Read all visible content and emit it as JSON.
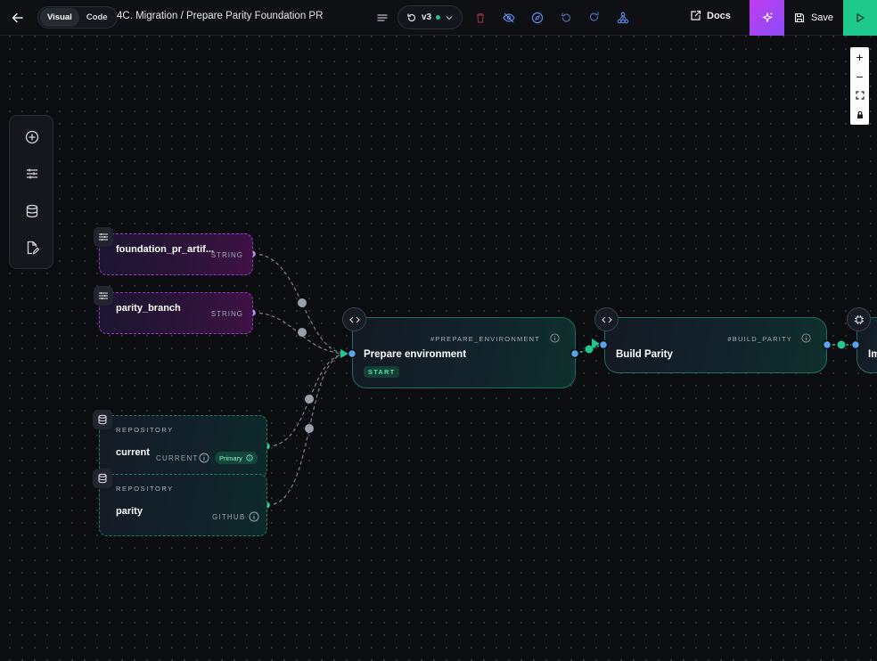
{
  "topbar": {
    "mode_tabs": [
      "Visual",
      "Code"
    ],
    "breadcrumb": "4C. Migration / Prepare Parity Foundation PR",
    "version": "v3",
    "docs_label": "Docs",
    "save_label": "Save"
  },
  "zoom_controls": [
    "+",
    "−",
    "fit",
    "lock"
  ],
  "left_toolbar": [
    "add-node-icon",
    "inputs-icon",
    "repositories-icon",
    "edit-file-icon"
  ],
  "inputs": [
    {
      "label": "foundation_pr_artif...",
      "type": "STRING"
    },
    {
      "label": "parity_branch",
      "type": "STRING"
    }
  ],
  "repositories": [
    {
      "kicker": "REPOSITORY",
      "label": "current",
      "kind": "CURRENT",
      "badge": "Primary"
    },
    {
      "kicker": "REPOSITORY",
      "label": "parity",
      "kind": "GITHUB"
    }
  ],
  "steps": [
    {
      "id": "#PREPARE_ENVIRONMENT",
      "title": "Prepare environment",
      "badge": "START"
    },
    {
      "id": "#BUILD_PARITY",
      "title": "Build Parity"
    },
    {
      "id": "",
      "title": "Im"
    }
  ],
  "colors": {
    "accent_green": "#22c78f",
    "input_purple": "#9a35c9",
    "port_blue": "#5aa4ef",
    "ai_gradient": "#c13cf2"
  }
}
